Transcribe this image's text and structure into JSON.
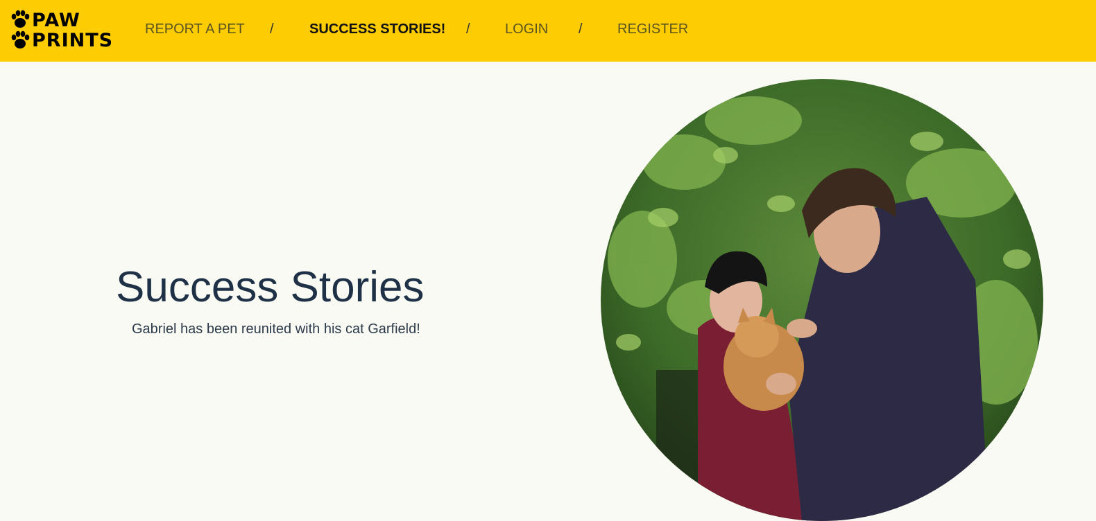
{
  "brand": {
    "line1": "PAW",
    "line2": "PRINTS",
    "icon": "paw-icon"
  },
  "nav": {
    "items": [
      {
        "label": "REPORT A PET",
        "active": false
      },
      {
        "label": "SUCCESS STORIES!",
        "active": true
      },
      {
        "label": "LOGIN",
        "active": false
      },
      {
        "label": "REGISTER",
        "active": false
      }
    ],
    "separator": "/"
  },
  "hero": {
    "title": "Success Stories",
    "subtitle": "Gabriel has been reunited with his cat Garfield!"
  },
  "colors": {
    "header_bg": "#fecc02",
    "page_bg": "#f9faf3",
    "title_text": "#1f3146"
  }
}
